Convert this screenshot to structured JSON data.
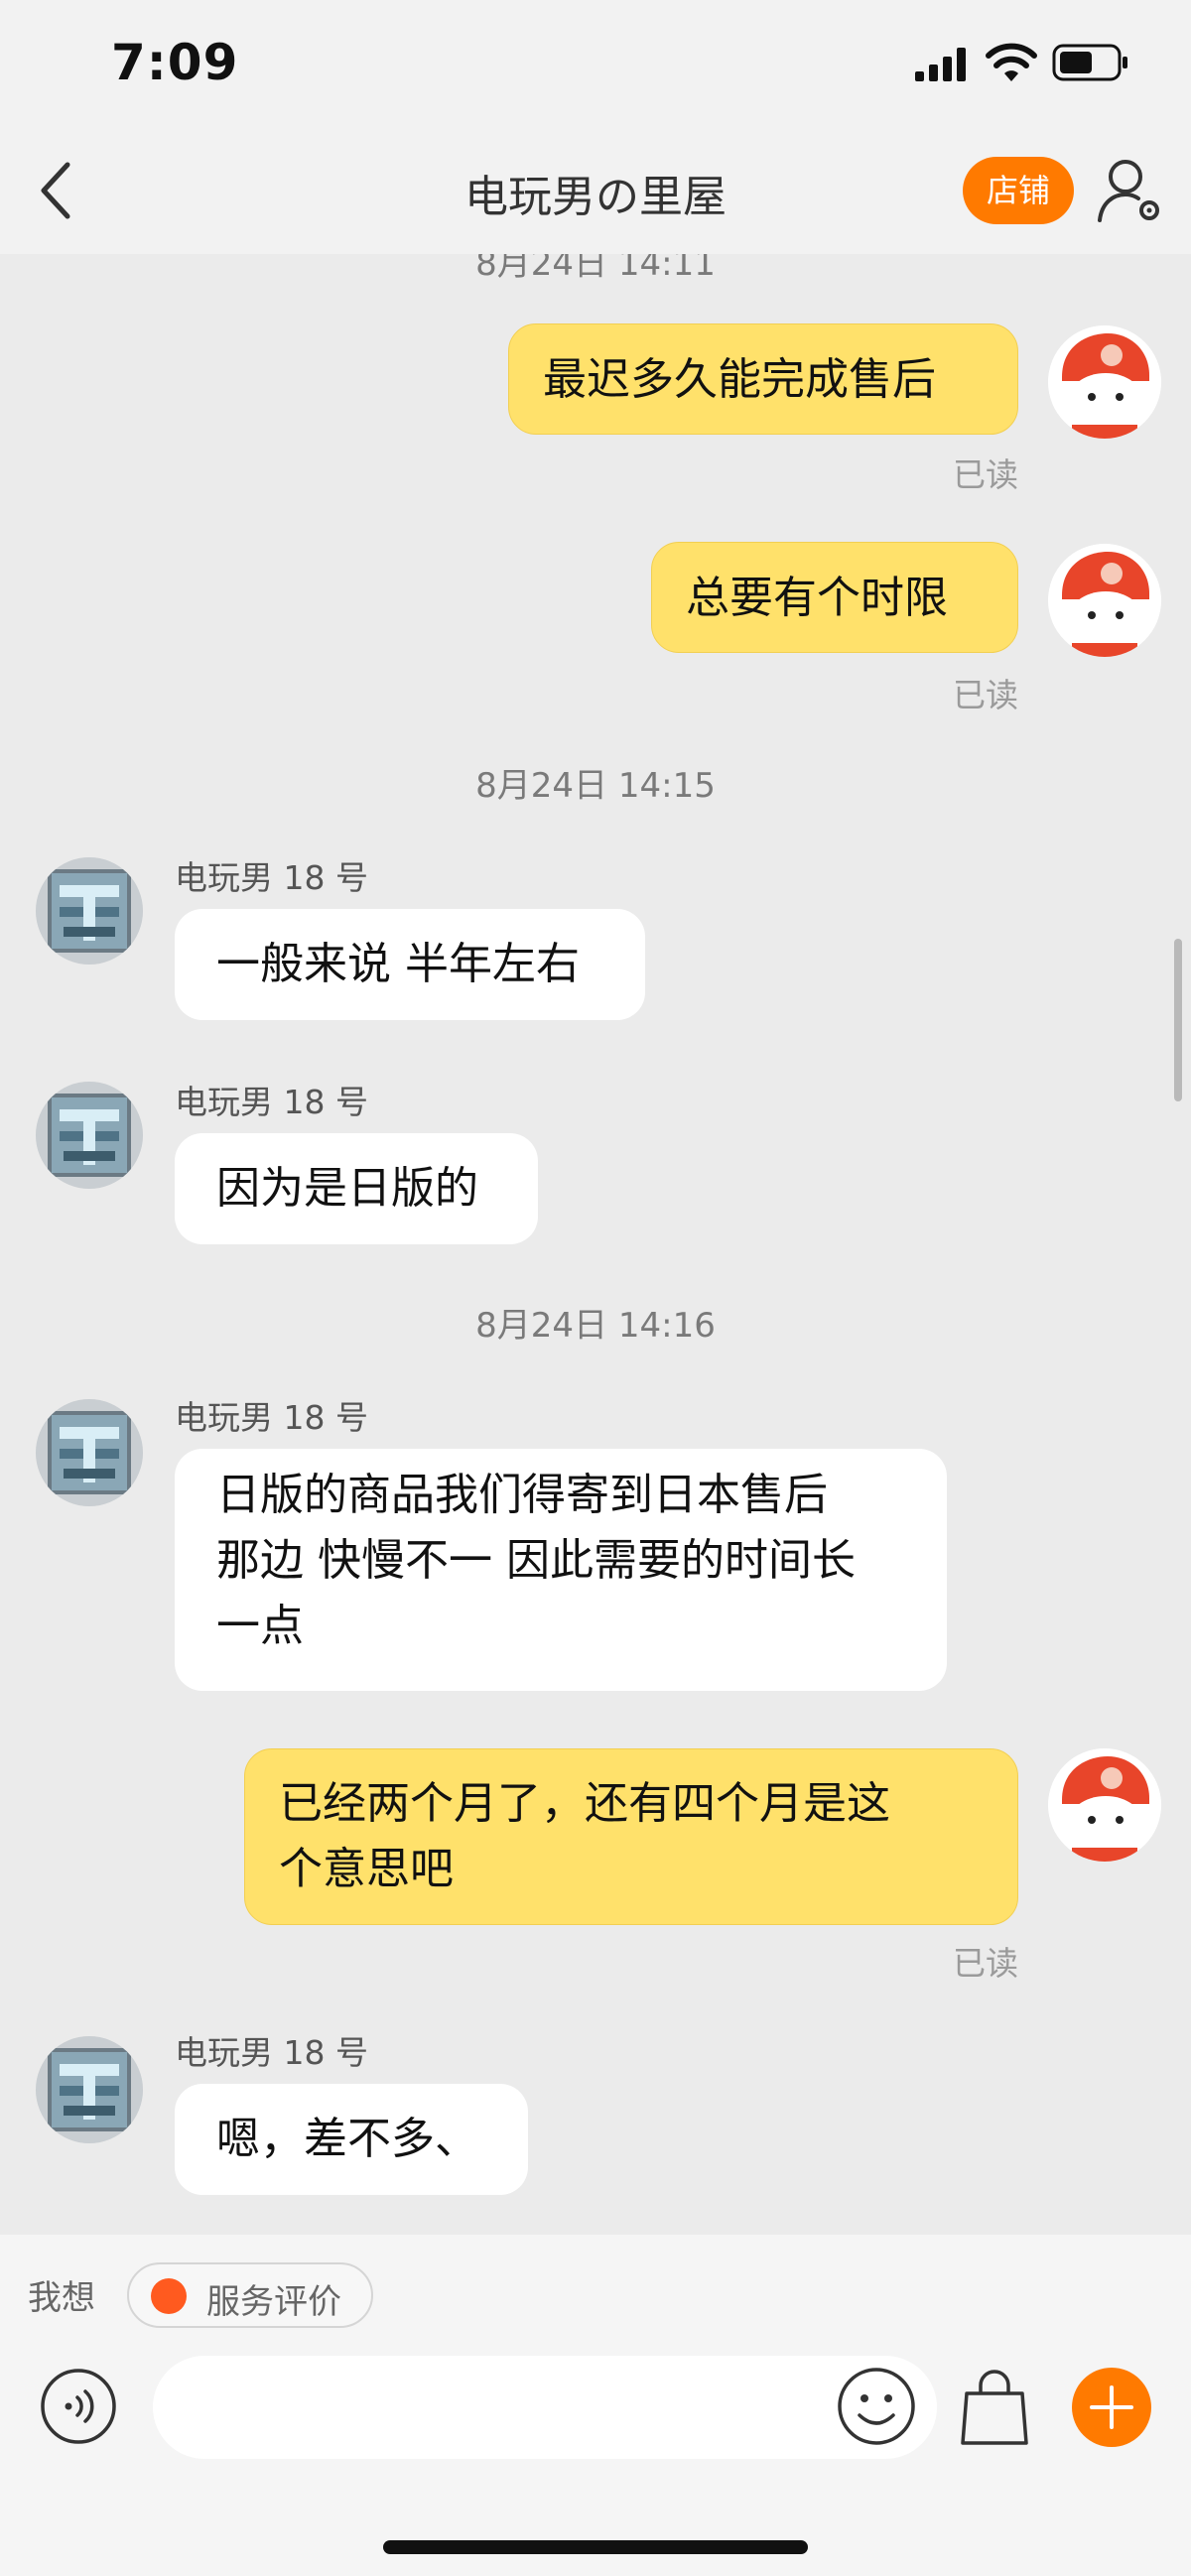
{
  "status": {
    "time": "7:09"
  },
  "header": {
    "title": "电玩男の里屋",
    "shop_label": "店铺"
  },
  "chat": {
    "partial_timestamp": "8月24日 14:11",
    "msg1": {
      "text": "最迟多久能完成售后",
      "status": "已读"
    },
    "msg2": {
      "text": "总要有个时限",
      "status": "已读"
    },
    "ts2": "8月24日 14:15",
    "msg3": {
      "sender": "电玩男 18 号",
      "text": "一般来说 半年左右"
    },
    "msg4": {
      "sender": "电玩男 18 号",
      "text": "因为是日版的"
    },
    "ts3": "8月24日 14:16",
    "msg5": {
      "sender": "电玩男 18 号",
      "lines": [
        "日版的商品我们得寄到日本售后",
        "那边 快慢不一 因此需要的时间长",
        "一点"
      ]
    },
    "msg6": {
      "lines": [
        "已经两个月了，还有四个月是这",
        "个意思吧"
      ],
      "status": "已读"
    },
    "msg7": {
      "sender": "电玩男 18 号",
      "text": "嗯，差不多、"
    }
  },
  "quick": {
    "label": "我想",
    "chip": "服务评价"
  },
  "icons": {
    "back": "chevron-left-icon",
    "profile": "user-settings-icon",
    "voice": "voice-icon",
    "emoji": "smiley-icon",
    "bag": "shopping-bag-icon",
    "plus": "plus-icon"
  },
  "colors": {
    "accent": "#ff7a00",
    "my_bubble": "#ffe16b",
    "chat_bg": "#ebebeb"
  }
}
